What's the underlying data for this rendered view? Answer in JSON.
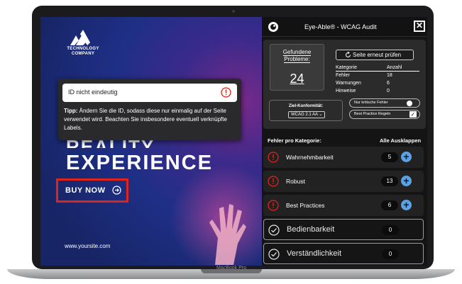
{
  "device": {
    "brand_label": "MacBook Pro"
  },
  "ad": {
    "logo_line1": "TECHNOLOGY",
    "logo_line2": "COMPANY",
    "headline_partial": "REALITY",
    "headline": "EXPERIENCE",
    "buy_label": "BUY NOW",
    "website": "www.yoursite.com"
  },
  "tooltip": {
    "title": "ID nicht eindeutig",
    "tip_label": "Tipp:",
    "tip_text": " Ändern Sie die ID, sodass diese nur einmalig auf der Seite verwendet wird. Beachten Sie insbesondere eventuell verknüpfte Labels."
  },
  "panel": {
    "title": "Eye-Able® - WCAG Audit",
    "found_label": "Gefundene Probleme:",
    "found_count": "24",
    "recheck_label": "Seite erneut prüfen",
    "stats_header": {
      "category": "Kategorie",
      "count": "Anzahl"
    },
    "stats": [
      {
        "label": "Fehler",
        "value": "18"
      },
      {
        "label": "Warnungen",
        "value": "6"
      },
      {
        "label": "Hinweise",
        "value": "0"
      }
    ],
    "level_label": "Ziel-Konformität:",
    "level_value": "WCAG 2.1 AA",
    "critical_toggle_label": "Nur kritische Fehler",
    "best_practice_label": "Best Practice Regeln",
    "section_title": "Fehler pro Kategorie:",
    "expand_all": "Alle Ausklappen",
    "categories": [
      {
        "label": "Wahrnehmbarkeit",
        "count": "5",
        "status": "error"
      },
      {
        "label": "Robust",
        "count": "13",
        "status": "error"
      },
      {
        "label": "Best Practices",
        "count": "6",
        "status": "error"
      },
      {
        "label": "Bedienbarkeit",
        "count": "0",
        "status": "pass"
      },
      {
        "label": "Verständlichkeit",
        "count": "0",
        "status": "pass"
      }
    ]
  },
  "colors": {
    "error": "#e2231a",
    "accent": "#5aa2e8",
    "panel_bg": "#141414"
  }
}
